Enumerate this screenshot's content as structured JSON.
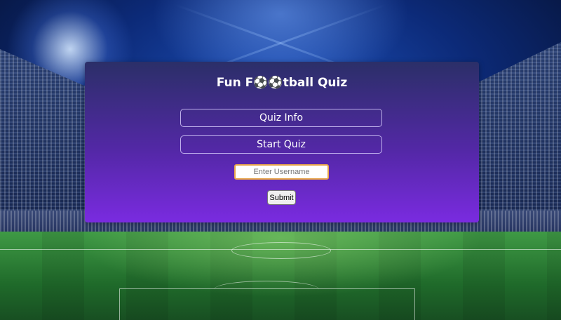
{
  "quiz": {
    "title": "Fun F⚽⚽tball Quiz",
    "quiz_info_label": "Quiz Info",
    "start_quiz_label": "Start Quiz",
    "username_placeholder": "Enter Username",
    "username_value": "",
    "submit_label": "Submit"
  },
  "colors": {
    "panel_top": "#2b2f68",
    "panel_bottom": "#7a2be0",
    "input_border": "#e8a64a"
  }
}
